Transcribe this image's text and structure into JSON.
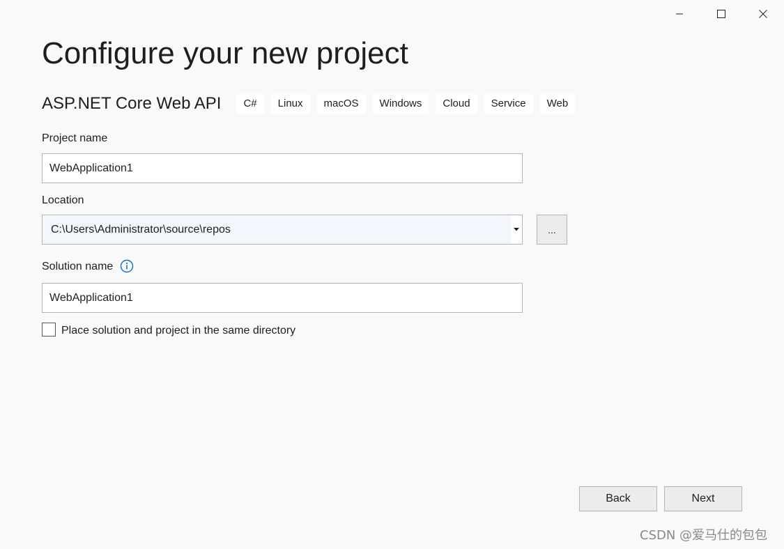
{
  "window": {
    "controls": [
      "minimize-icon",
      "maximize-icon",
      "close-icon"
    ]
  },
  "title": "Configure your new project",
  "template": {
    "name": "ASP.NET Core Web API",
    "tags": [
      "C#",
      "Linux",
      "macOS",
      "Windows",
      "Cloud",
      "Service",
      "Web"
    ]
  },
  "project_name": {
    "label": "Project name",
    "value": "WebApplication1"
  },
  "location": {
    "label": "Location",
    "value": "C:\\Users\\Administrator\\source\\repos",
    "browse_label": "..."
  },
  "solution_name": {
    "label": "Solution name",
    "value": "WebApplication1",
    "info_icon": "info-icon"
  },
  "same_directory": {
    "label": "Place solution and project in the same directory",
    "checked": false
  },
  "buttons": {
    "back": "Back",
    "next": "Next"
  },
  "watermark": "CSDN @爱马仕的包包",
  "colors": {
    "background": "#f9f9f9",
    "info_accent": "#0e70c0",
    "combo_background": "#f3f6fd"
  }
}
